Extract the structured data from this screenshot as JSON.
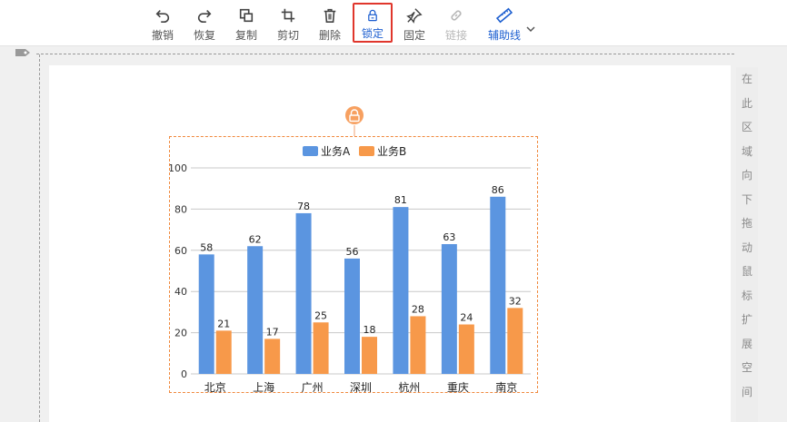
{
  "toolbar": {
    "items": [
      {
        "label": "撤销",
        "icon": "undo-icon"
      },
      {
        "label": "恢复",
        "icon": "redo-icon"
      },
      {
        "label": "复制",
        "icon": "copy-icon"
      },
      {
        "label": "剪切",
        "icon": "crop-icon"
      },
      {
        "label": "删除",
        "icon": "trash-icon"
      },
      {
        "label": "锁定",
        "icon": "lock-icon",
        "active": true
      },
      {
        "label": "固定",
        "icon": "pin-icon"
      },
      {
        "label": "链接",
        "icon": "link-icon",
        "disabled": true
      },
      {
        "label": "辅助线",
        "icon": "ruler-icon",
        "has_dropdown": true
      }
    ]
  },
  "side_panel": {
    "text": [
      "在",
      "此",
      "区",
      "域",
      "向",
      "下",
      "拖",
      "动",
      "鼠",
      "标",
      "扩",
      "展",
      "空",
      "间"
    ]
  },
  "colors": {
    "series_a": "#5b95e0",
    "series_b": "#f7994a",
    "accent": "#1d5fd0",
    "active_border": "#e0362c",
    "selection": "#f0883c"
  },
  "chart_data": {
    "type": "bar",
    "categories": [
      "北京",
      "上海",
      "广州",
      "深圳",
      "杭州",
      "重庆",
      "南京"
    ],
    "series": [
      {
        "name": "业务A",
        "values": [
          58,
          62,
          78,
          56,
          81,
          63,
          86
        ]
      },
      {
        "name": "业务B",
        "values": [
          21,
          17,
          25,
          18,
          28,
          24,
          32
        ]
      }
    ],
    "ylim": [
      0,
      100
    ],
    "yticks": [
      0,
      20,
      40,
      60,
      80,
      100
    ],
    "grid": true,
    "legend": "top-center",
    "data_labels": true
  }
}
